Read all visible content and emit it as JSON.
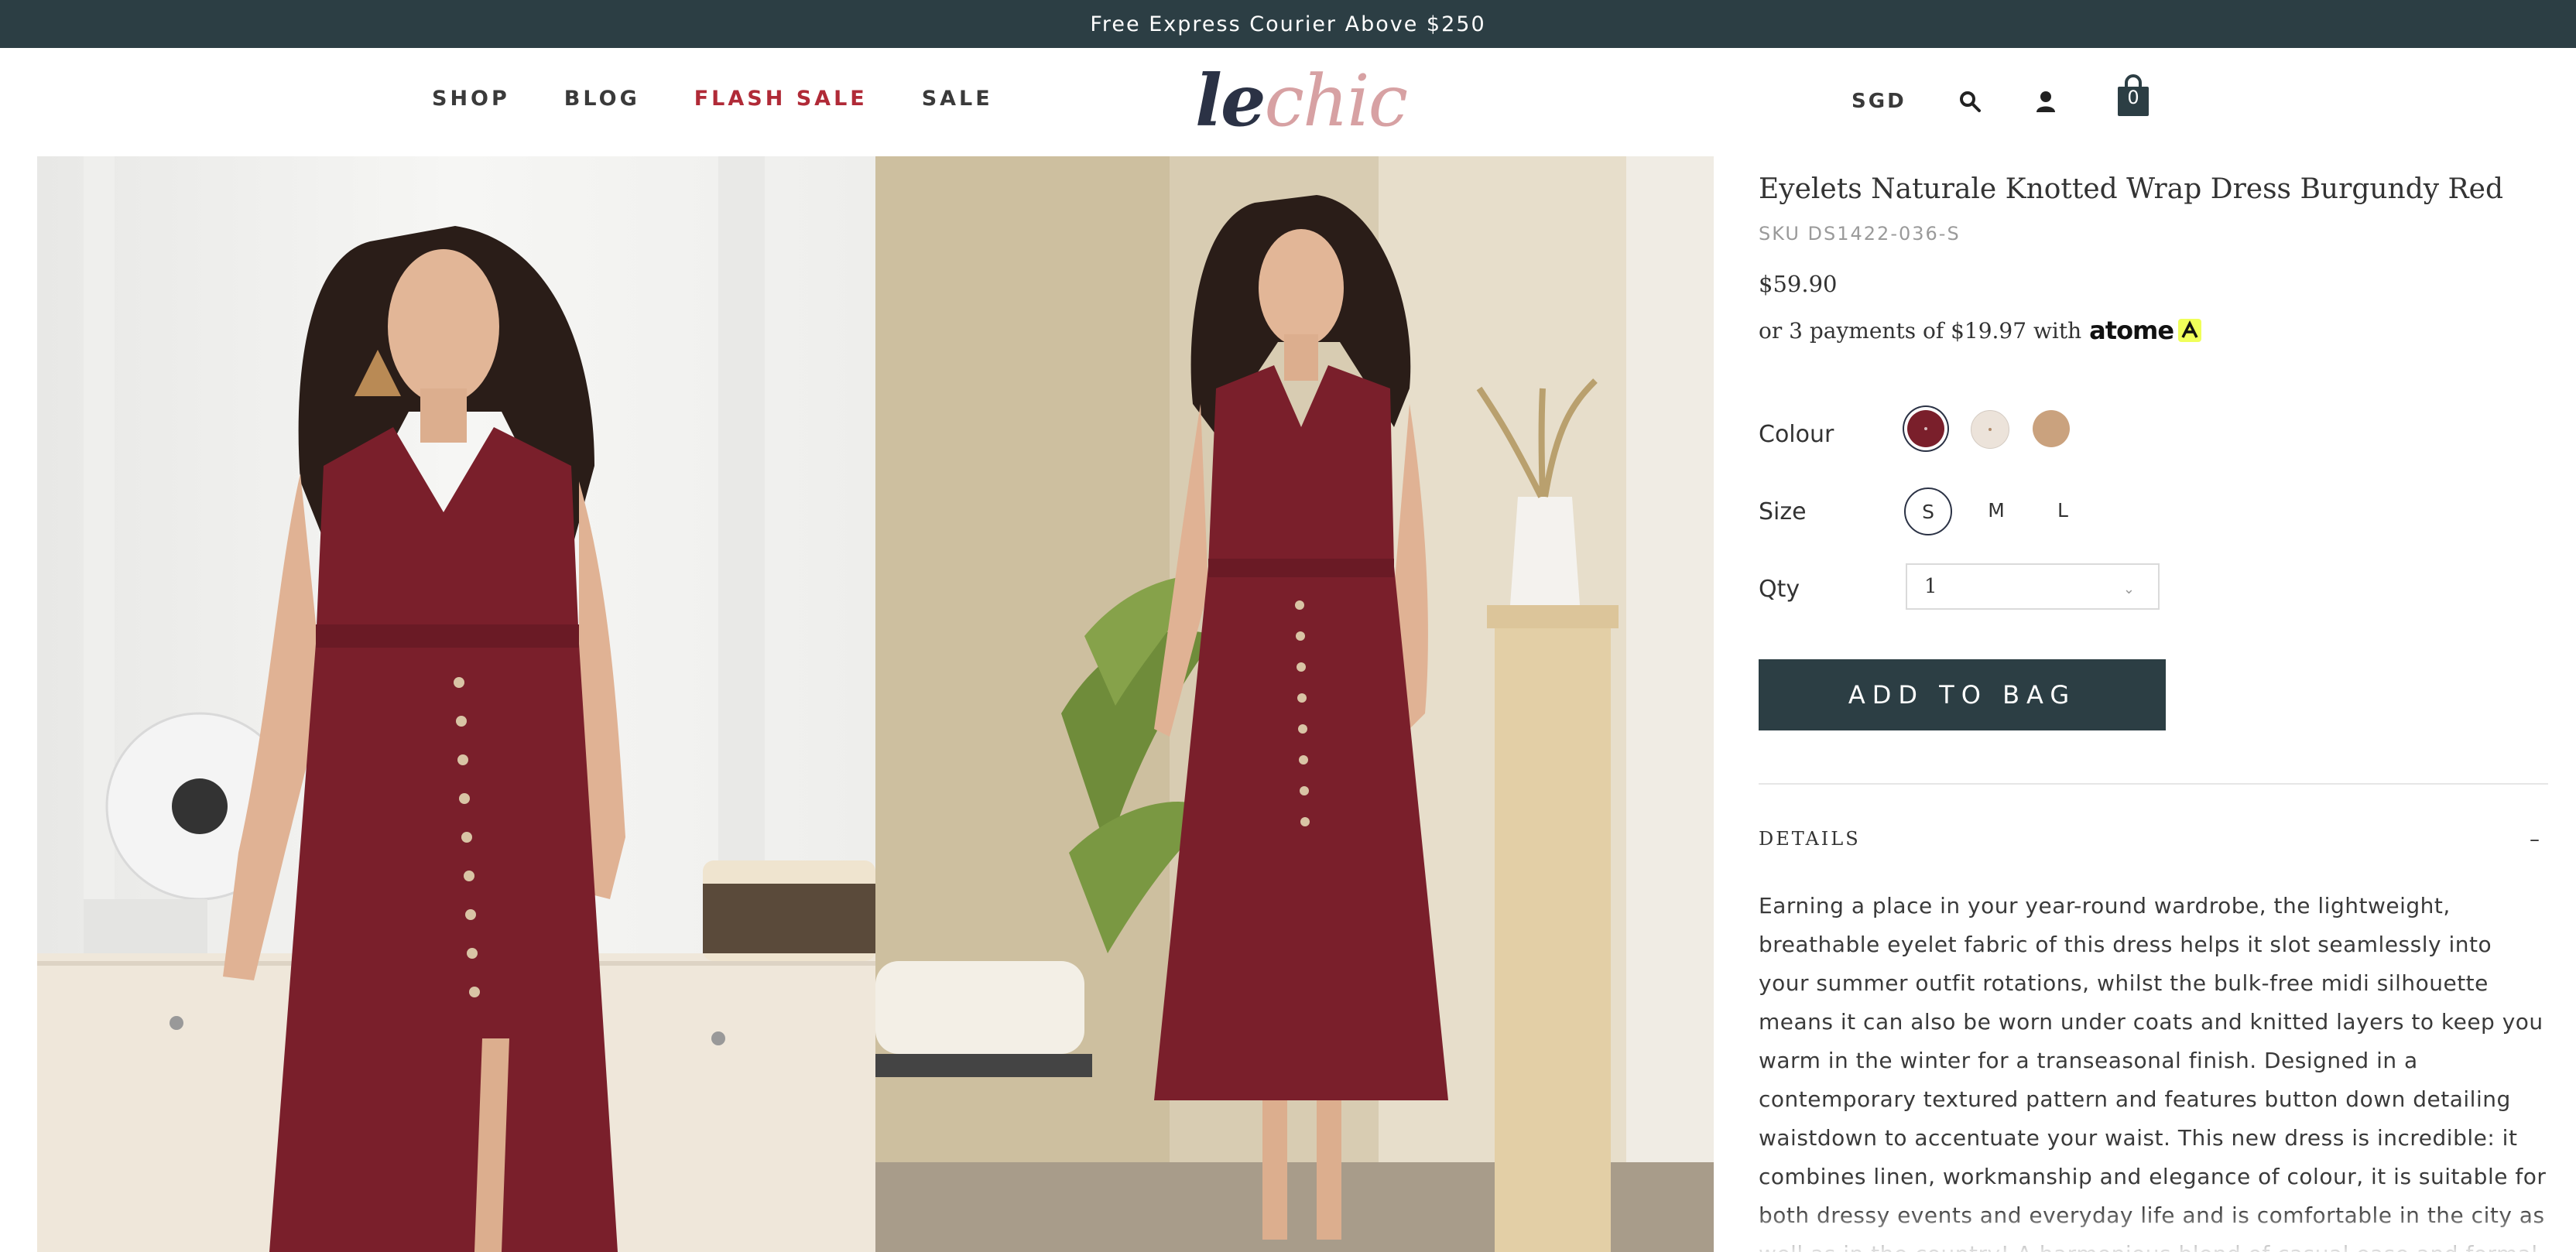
{
  "announcement": "Free Express Courier Above $250",
  "nav": {
    "items": [
      {
        "label": "SHOP"
      },
      {
        "label": "BLOG"
      },
      {
        "label": "FLASH SALE",
        "color": "#b02a37"
      },
      {
        "label": "SALE"
      }
    ]
  },
  "logo": {
    "part1": "le",
    "part2": "chic"
  },
  "header": {
    "currency": "SGD",
    "bag_count": "0",
    "icons": [
      "search-icon",
      "user-icon",
      "bag-icon"
    ]
  },
  "product": {
    "title": "Eyelets Naturale Knotted Wrap Dress Burgundy Red",
    "sku": "SKU DS1422-036-S",
    "price": "$59.90",
    "installment_text": "or 3 payments of $19.97 with",
    "installment_provider": "atome",
    "colour_label": "Colour",
    "colours": [
      "#7a1f2b",
      "#ece3da",
      "#caa27e"
    ],
    "selected_colour_index": 0,
    "size_label": "Size",
    "sizes": [
      "S",
      "M",
      "L"
    ],
    "selected_size": "S",
    "qty_label": "Qty",
    "qty_value": "1",
    "add_to_bag": "ADD TO BAG",
    "details_heading": "DETAILS",
    "details_toggle": "–",
    "details_text": "Earning a place in your year-round wardrobe, the lightweight, breathable eyelet fabric of this dress helps it slot seamlessly into your summer outfit rotations, whilst the bulk-free midi silhouette means it can also be worn under coats and knitted layers to keep you warm in the winter for a transeasonal finish. Designed in a contemporary textured pattern and features button down detailing waistdown to accentuate your waist. This new dress is incredible: it combines linen, workmanship and elegance of colour, it is suitable for both dressy events and everyday life and is comfortable in the city as well as in the country! A harmonious blend of casual ease and formal grace. This solid-hued masterpiece effortlessly adapts to any setting, radiating relaxed charm."
  },
  "colors": {
    "dark_teal": "#2c3e44",
    "burgundy": "#7a1f2b",
    "logo_navy": "#2b3245",
    "logo_pink": "#d7a1a3"
  }
}
